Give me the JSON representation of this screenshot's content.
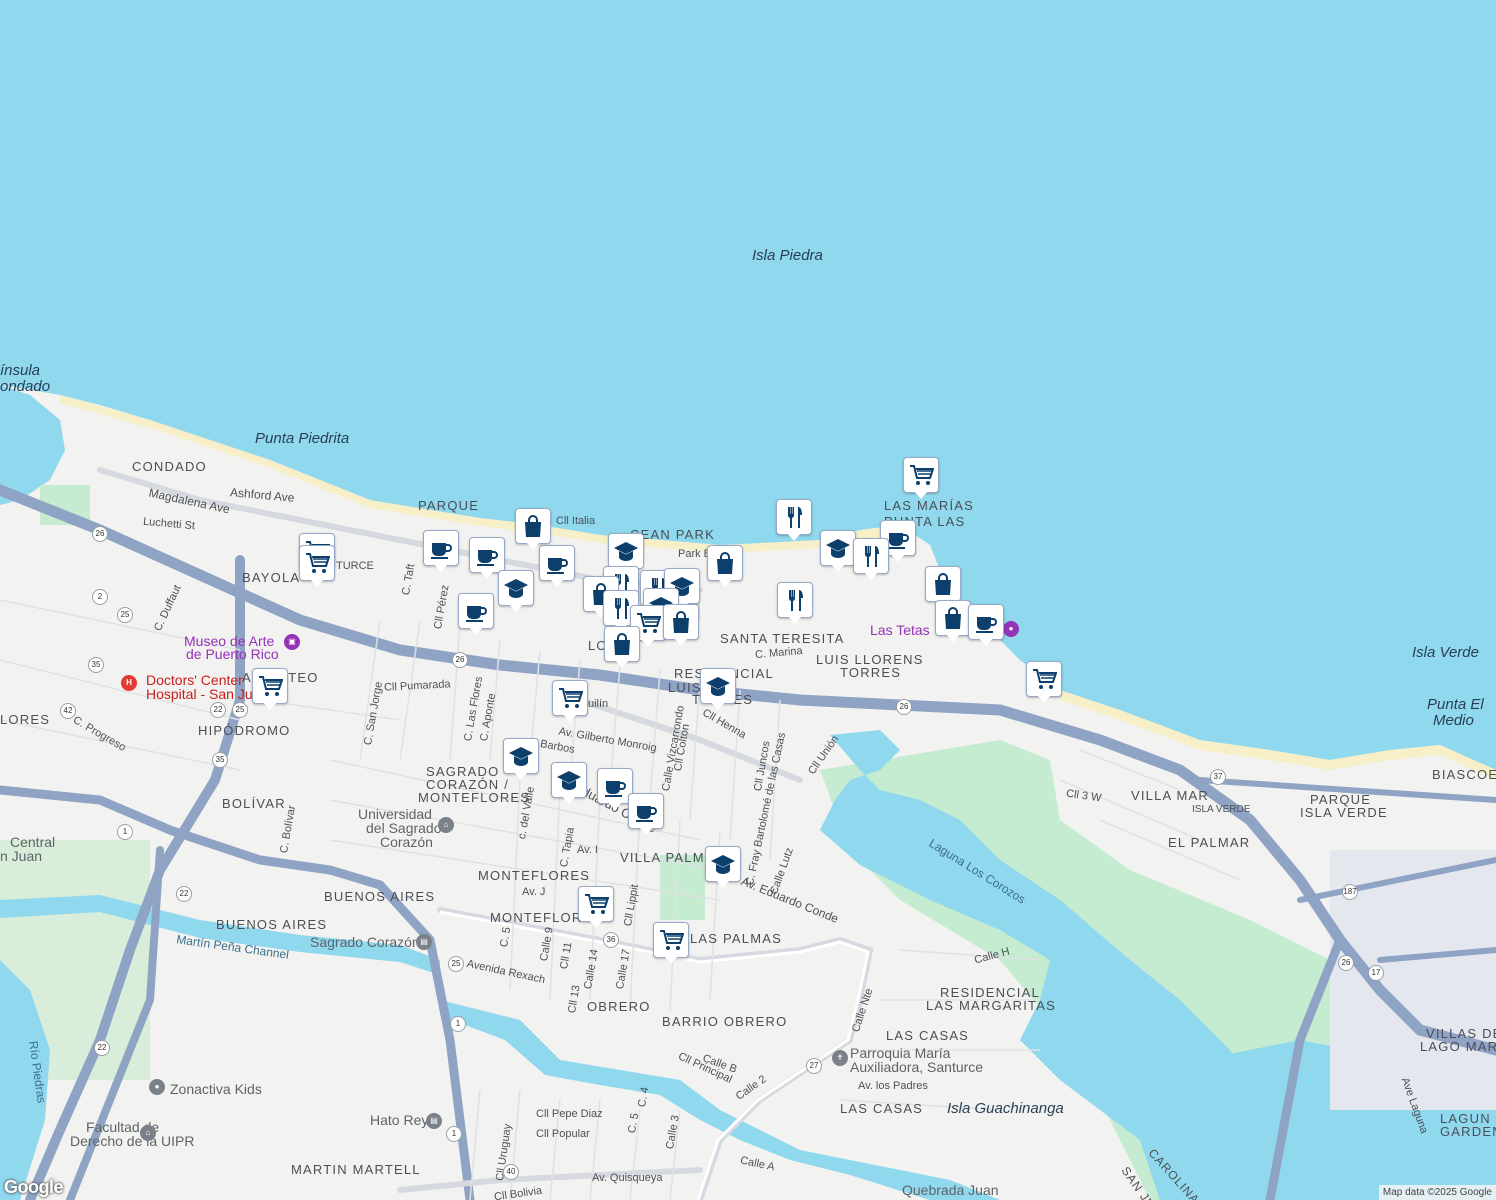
{
  "map": {
    "water_labels": [
      {
        "id": "isla-piedra",
        "text": "Isla Piedra"
      },
      {
        "id": "punta-piedrita",
        "text": "Punta Piedrita"
      },
      {
        "id": "isla-verde",
        "text": "Isla Verde"
      },
      {
        "id": "punta-el-medio-1",
        "text": "Punta El"
      },
      {
        "id": "punta-el-medio-2",
        "text": "Medio"
      },
      {
        "id": "isla-guachinanga",
        "text": "Isla Guachinanga"
      },
      {
        "id": "peninsula-1",
        "text": "ínsula"
      },
      {
        "id": "peninsula-2",
        "text": "ondado"
      }
    ],
    "neighborhoods": [
      {
        "id": "condado",
        "text": "CONDADO"
      },
      {
        "id": "parque",
        "text": "PARQUE"
      },
      {
        "id": "ocean-park",
        "text": "CEAN PARK"
      },
      {
        "id": "bayola",
        "text": "BAYOLA"
      },
      {
        "id": "las-marias",
        "text": "LAS MARÍAS"
      },
      {
        "id": "punta-las-marias-1",
        "text": "PUNTA LAS"
      },
      {
        "id": "punta-las-marias-2",
        "text": "M"
      },
      {
        "id": "santa-teresita",
        "text": "SANTA TERESITA"
      },
      {
        "id": "luis-llorens-1",
        "text": "LUIS LLORENS"
      },
      {
        "id": "luis-llorens-2",
        "text": "TORRES"
      },
      {
        "id": "residencial-1",
        "text": "RESIDENCIAL"
      },
      {
        "id": "residencial-2",
        "text": "LUIS"
      },
      {
        "id": "residencial-3",
        "text": "TORRES"
      },
      {
        "id": "san-mateo",
        "text": "AN MATEO"
      },
      {
        "id": "hipodromo",
        "text": "HIPÓDROMO"
      },
      {
        "id": "bolivar",
        "text": "BOLÍVAR"
      },
      {
        "id": "sagrado-1",
        "text": "SAGRADO"
      },
      {
        "id": "sagrado-2",
        "text": "CORAZÓN /"
      },
      {
        "id": "sagrado-3",
        "text": "MONTEFLORES"
      },
      {
        "id": "villa-palmeras",
        "text": "VILLA PALMER"
      },
      {
        "id": "monteflores",
        "text": "MONTEFLORES"
      },
      {
        "id": "monteflores-2",
        "text": "MONTEFLOR"
      },
      {
        "id": "buenos-aires-1",
        "text": "BUENOS AIRES"
      },
      {
        "id": "buenos-aires-2",
        "text": "BUENOS AIRES"
      },
      {
        "id": "las-palmas",
        "text": "LAS PALMAS"
      },
      {
        "id": "obrero",
        "text": "OBRERO"
      },
      {
        "id": "barrio-obrero",
        "text": "BARRIO OBRERO"
      },
      {
        "id": "res-margaritas-1",
        "text": "RESIDENCIAL"
      },
      {
        "id": "res-margaritas-2",
        "text": "LAS MARGARITAS"
      },
      {
        "id": "las-casas-1",
        "text": "LAS CASAS"
      },
      {
        "id": "las-casas-2",
        "text": "LAS CASAS"
      },
      {
        "id": "martin-martell",
        "text": "MARTIN MARTELL"
      },
      {
        "id": "villa-mar",
        "text": "VILLA MAR"
      },
      {
        "id": "isla-verde-hood",
        "text": "ISLA VERDE"
      },
      {
        "id": "parque-isla-verde-1",
        "text": "PARQUE"
      },
      {
        "id": "parque-isla-verde-2",
        "text": "ISLA VERDE"
      },
      {
        "id": "el-palmar",
        "text": "EL PALMAR"
      },
      {
        "id": "biascoe",
        "text": "BIASCOE"
      },
      {
        "id": "villas-lago-1",
        "text": "VILLAS DE"
      },
      {
        "id": "villas-lago-2",
        "text": "LAGO MAR"
      },
      {
        "id": "laguna-gardens-1",
        "text": "LAGUN"
      },
      {
        "id": "laguna-gardens-2",
        "text": "GARDEN"
      },
      {
        "id": "lores",
        "text": "LORES"
      },
      {
        "id": "lo",
        "text": "LO"
      },
      {
        "id": "ma",
        "text": "M"
      },
      {
        "id": "ma2",
        "text": "M"
      }
    ],
    "streets": [
      {
        "id": "ashford",
        "text": "Ashford Ave"
      },
      {
        "id": "magdalena",
        "text": "Magdalena Ave"
      },
      {
        "id": "luchetti",
        "text": "Luchetti St"
      },
      {
        "id": "cll-italia",
        "text": "Cll Italia"
      },
      {
        "id": "park-b",
        "text": "Park B"
      },
      {
        "id": "c-taft",
        "text": "C. Taft"
      },
      {
        "id": "cll-perez",
        "text": "Cll Pérez"
      },
      {
        "id": "c-san-jorge",
        "text": "C. San Jorge"
      },
      {
        "id": "cll-pumarada",
        "text": "Cll Pumarada"
      },
      {
        "id": "c-las-flores",
        "text": "C. Las Flores"
      },
      {
        "id": "c-aponte",
        "text": "C. Aponte"
      },
      {
        "id": "c-duffaut",
        "text": "C. Duffaut"
      },
      {
        "id": "c-progreso",
        "text": "C. Progreso"
      },
      {
        "id": "c-bolivar",
        "text": "C. Bolívar"
      },
      {
        "id": "av-gilberto",
        "text": "Av. Gilberto Monroig"
      },
      {
        "id": "barbos",
        "text": "Barbos"
      },
      {
        "id": "cll-colton",
        "text": "Cll Colton"
      },
      {
        "id": "calle-vizcarrondo",
        "text": "Calle Vizcarrondo"
      },
      {
        "id": "cll-henna",
        "text": "Cll Henna"
      },
      {
        "id": "cll-juncos",
        "text": "Cll Juncos"
      },
      {
        "id": "fray-bartolome",
        "text": "C. Fray Bartolomé de las Casas"
      },
      {
        "id": "cll-union",
        "text": "Cll Unión"
      },
      {
        "id": "c-marina",
        "text": "C. Marina"
      },
      {
        "id": "c-del-valle",
        "text": "c. del Valle"
      },
      {
        "id": "c-tapia",
        "text": "C. Tapia"
      },
      {
        "id": "eduardo-conde-1",
        "text": "Eduardo Conde"
      },
      {
        "id": "eduardo-conde-2",
        "text": "Av. Eduardo Conde"
      },
      {
        "id": "calle-lutz",
        "text": "Calle Lutz"
      },
      {
        "id": "av-j",
        "text": "Av. J"
      },
      {
        "id": "av-i",
        "text": "Av. I"
      },
      {
        "id": "c-5",
        "text": "C. 5"
      },
      {
        "id": "calle-9",
        "text": "Calle 9"
      },
      {
        "id": "cll-11",
        "text": "Cll 11"
      },
      {
        "id": "cll-13",
        "text": "Cll 13"
      },
      {
        "id": "calle-14",
        "text": "Calle 14"
      },
      {
        "id": "calle-17",
        "text": "Calle 17"
      },
      {
        "id": "cll-lippit",
        "text": "Cll Lippit"
      },
      {
        "id": "avenida-rexach",
        "text": "Avenida Rexach"
      },
      {
        "id": "calle-h",
        "text": "Calle H"
      },
      {
        "id": "calle-nte",
        "text": "Calle Nte"
      },
      {
        "id": "calle-b",
        "text": "Calle B"
      },
      {
        "id": "cll-principal",
        "text": "Cll Principal"
      },
      {
        "id": "calle-2",
        "text": "Calle 2"
      },
      {
        "id": "av-los-padres",
        "text": "Av. los Padres"
      },
      {
        "id": "cll-pepe-diaz",
        "text": "Cll Pepe Diaz"
      },
      {
        "id": "cll-popular",
        "text": "Cll Popular"
      },
      {
        "id": "cll-uruguay",
        "text": "Cll Uruguay"
      },
      {
        "id": "c-4",
        "text": "C. 4"
      },
      {
        "id": "c-5b",
        "text": "C. 5"
      },
      {
        "id": "calle-3",
        "text": "Calle 3"
      },
      {
        "id": "calle-a",
        "text": "Calle A"
      },
      {
        "id": "av-quisqueya",
        "text": "Av. Quisqueya"
      },
      {
        "id": "cll-bolivia",
        "text": "Cll Bolivia"
      },
      {
        "id": "cll-3w",
        "text": "Cll 3 W"
      },
      {
        "id": "ave-laguna",
        "text": "Ave Laguna"
      },
      {
        "id": "martin-pena",
        "text": "Martín Peña Channel"
      },
      {
        "id": "rio-piedras",
        "text": "Río Piedras"
      },
      {
        "id": "laguna-corozos",
        "text": "Laguna Los Corozos"
      },
      {
        "id": "carolina",
        "text": "CAROLINA"
      },
      {
        "id": "san-juan",
        "text": "SAN JU"
      },
      {
        "id": "ulin",
        "text": "uilín"
      },
      {
        "id": "urce",
        "text": "TURCE"
      },
      {
        "id": "c-ap",
        "text": "C. Ap"
      },
      {
        "id": "c-a",
        "text": "C"
      },
      {
        "id": "calle-edge",
        "text": "Calle"
      },
      {
        "id": "mo",
        "text": "ora"
      }
    ],
    "pois": [
      {
        "id": "museo-1",
        "text": "Museo de Arte"
      },
      {
        "id": "museo-2",
        "text": "de Puerto Rico"
      },
      {
        "id": "doctors-1",
        "text": "Doctors' Center"
      },
      {
        "id": "doctors-2",
        "text": "Hospital - San Ju"
      },
      {
        "id": "universidad-1",
        "text": "Universidad"
      },
      {
        "id": "universidad-2",
        "text": "del Sagrado"
      },
      {
        "id": "universidad-3",
        "text": "Corazón"
      },
      {
        "id": "sagrado-station",
        "text": "Sagrado Corazón"
      },
      {
        "id": "hato-rey",
        "text": "Hato Rey"
      },
      {
        "id": "zonactiva",
        "text": "Zonactiva Kids"
      },
      {
        "id": "facultad-1",
        "text": "Facultad de"
      },
      {
        "id": "facultad-2",
        "text": "Derecho de la UIPR"
      },
      {
        "id": "las-tetas",
        "text": "Las Tetas"
      },
      {
        "id": "parroquia-1",
        "text": "Parroquia María"
      },
      {
        "id": "parroquia-2",
        "text": "Auxiliadora, Santurce"
      },
      {
        "id": "central-1",
        "text": "Central"
      },
      {
        "id": "central-2",
        "text": "n Juan"
      },
      {
        "id": "quebrada",
        "text": "Quebrada Juan"
      }
    ],
    "route_shields": [
      "26",
      "2",
      "25",
      "35",
      "42",
      "22",
      "25",
      "35",
      "1",
      "22",
      "26",
      "37",
      "187",
      "26",
      "17",
      "36",
      "25",
      "1",
      "27",
      "1",
      "40",
      "22"
    ],
    "markers": [
      {
        "type": "cafe",
        "icon": "coffee-cup-icon"
      },
      {
        "type": "shopping",
        "icon": "shopping-bag-icon"
      },
      {
        "type": "grocery",
        "icon": "shopping-cart-icon"
      },
      {
        "type": "restaurant",
        "icon": "fork-knife-icon"
      },
      {
        "type": "school",
        "icon": "graduation-cap-icon"
      }
    ],
    "colors": {
      "water": "#8fd8ee",
      "land": "#f2f2f0",
      "highway": "#8fa3c4",
      "park": "#c5ebd0",
      "marker_icon": "#0c3f6b",
      "beach": "#f7efc8"
    },
    "attribution": "Map data ©2025 Google",
    "logo": "Google"
  }
}
